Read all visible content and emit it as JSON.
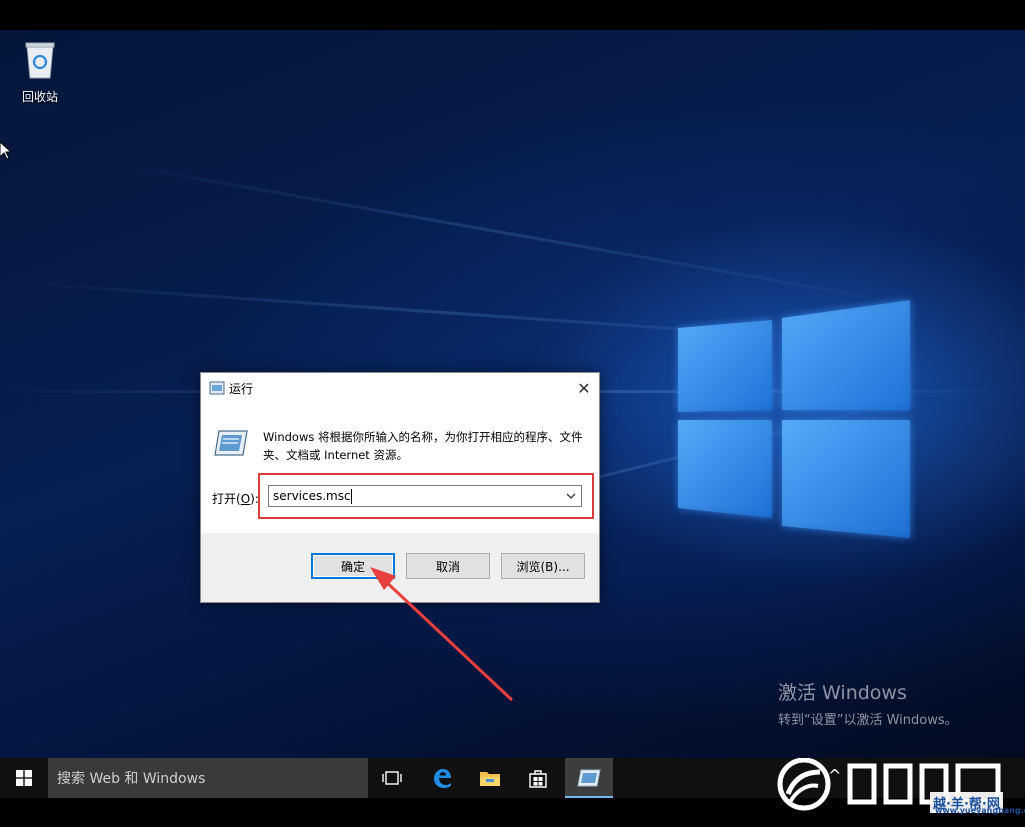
{
  "desktop": {
    "recycle_bin_label": "回收站",
    "activation": {
      "title": "激活 Windows",
      "subtitle": "转到“设置”以激活 Windows。"
    }
  },
  "run_dialog": {
    "title": "运行",
    "close_glyph": "✕",
    "description": "Windows 将根据你所输入的名称，为你打开相应的程序、文件夹、文档或 Internet 资源。",
    "open_label_prefix": "打开(",
    "open_label_key": "O",
    "open_label_suffix": "):",
    "open_value": "services.msc",
    "buttons": {
      "ok": "确定",
      "cancel": "取消",
      "browse": "浏览(B)..."
    }
  },
  "taskbar": {
    "search_placeholder": "搜索 Web 和 Windows",
    "tray_up_glyph": "^"
  },
  "watermark_brand": {
    "badge": "越·羊·帮·网",
    "url": "www.yueyangbang.com"
  },
  "colors": {
    "accent": "#0078d7",
    "highlight_box": "#e03b3b",
    "taskbar": "#101010"
  }
}
